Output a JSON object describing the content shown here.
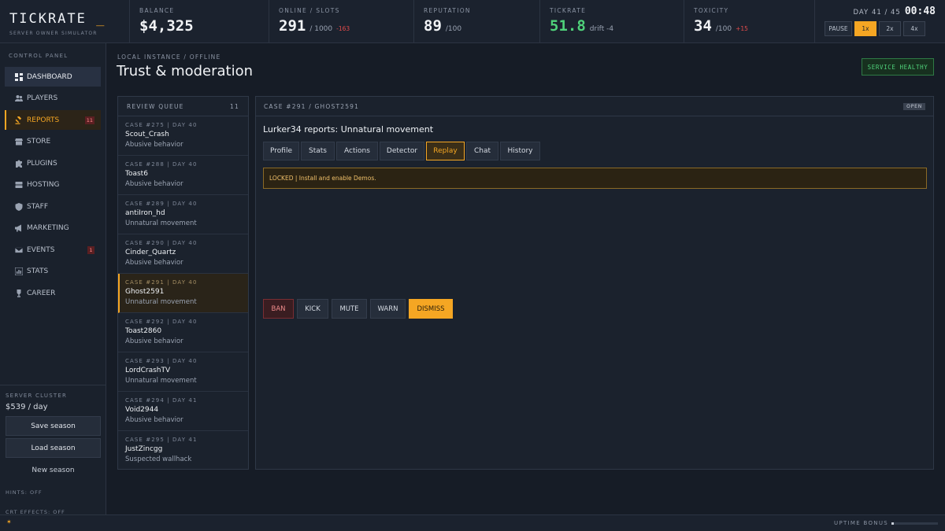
{
  "brand": {
    "title": "TICKRATE",
    "cursor": "_",
    "subtitle": "SERVER OWNER SIMULATOR"
  },
  "stats": {
    "balance": {
      "label": "BALANCE",
      "value": "$4,325"
    },
    "online": {
      "label": "ONLINE / SLOTS",
      "value": "291",
      "slots": "/ 1000",
      "delta": "-163"
    },
    "reputation": {
      "label": "REPUTATION",
      "value": "89",
      "max": "/100"
    },
    "tickrate": {
      "label": "TICKRATE",
      "value": "51.8",
      "drift": "drift -4"
    },
    "toxicity": {
      "label": "TOXICITY",
      "value": "34",
      "max": "/100",
      "delta": "+15"
    }
  },
  "clock": {
    "day": "DAY 41 / 45",
    "time": "00:48",
    "speeds": [
      "PAUSE",
      "1x",
      "2x",
      "4x"
    ],
    "active_speed": "1x"
  },
  "sidebar": {
    "section_label": "CONTROL PANEL",
    "items": [
      {
        "label": "DASHBOARD",
        "icon": "dashboard-icon"
      },
      {
        "label": "PLAYERS",
        "icon": "players-icon"
      },
      {
        "label": "REPORTS",
        "icon": "gavel-icon",
        "badge": "11"
      },
      {
        "label": "STORE",
        "icon": "store-icon"
      },
      {
        "label": "PLUGINS",
        "icon": "puzzle-icon"
      },
      {
        "label": "HOSTING",
        "icon": "server-icon"
      },
      {
        "label": "STAFF",
        "icon": "shield-icon"
      },
      {
        "label": "MARKETING",
        "icon": "megaphone-icon"
      },
      {
        "label": "EVENTS",
        "icon": "mail-icon",
        "badge": "1"
      },
      {
        "label": "STATS",
        "icon": "chart-icon"
      },
      {
        "label": "CAREER",
        "icon": "trophy-icon"
      }
    ],
    "active_item": "REPORTS",
    "hover_item": "DASHBOARD",
    "cluster_label": "SERVER CLUSTER",
    "cluster_cost": "$539 / day",
    "save_label": "Save season",
    "load_label": "Load season",
    "new_label": "New season",
    "hints": "HINTS: OFF",
    "crt": "CRT EFFECTS: OFF"
  },
  "main": {
    "breadcrumb": "LOCAL INSTANCE / OFFLINE",
    "title": "Trust & moderation",
    "health": "SERVICE HEALTHY"
  },
  "queue": {
    "title": "REVIEW QUEUE",
    "count": "11",
    "items": [
      {
        "meta": "CASE #275 | DAY 40",
        "name": "Scout_Crash",
        "reason": "Abusive behavior"
      },
      {
        "meta": "CASE #288 | DAY 40",
        "name": "Toast6",
        "reason": "Abusive behavior"
      },
      {
        "meta": "CASE #289 | DAY 40",
        "name": "antiIron_hd",
        "reason": "Unnatural movement"
      },
      {
        "meta": "CASE #290 | DAY 40",
        "name": "Cinder_Quartz",
        "reason": "Abusive behavior"
      },
      {
        "meta": "CASE #291 | DAY 40",
        "name": "Ghost2591",
        "reason": "Unnatural movement"
      },
      {
        "meta": "CASE #292 | DAY 40",
        "name": "Toast2860",
        "reason": "Abusive behavior"
      },
      {
        "meta": "CASE #293 | DAY 40",
        "name": "LordCrashTV",
        "reason": "Unnatural movement"
      },
      {
        "meta": "CASE #294 | DAY 41",
        "name": "Void2944",
        "reason": "Abusive behavior"
      },
      {
        "meta": "CASE #295 | DAY 41",
        "name": "JustZincgg",
        "reason": "Suspected wallhack"
      }
    ],
    "selected_index": 4
  },
  "case": {
    "id": "CASE #291 / GHOST2591",
    "status": "OPEN",
    "title": "Lurker34 reports: Unnatural movement",
    "tabs": [
      "Profile",
      "Stats",
      "Actions",
      "Detector",
      "Replay",
      "Chat",
      "History"
    ],
    "active_tab": "Replay",
    "locked_message": "LOCKED | Install and enable Demos.",
    "actions": [
      "BAN",
      "KICK",
      "MUTE",
      "WARN",
      "DISMISS"
    ]
  },
  "footer": {
    "uptime_label": "UPTIME BONUS",
    "uptime_progress": 0.05
  }
}
